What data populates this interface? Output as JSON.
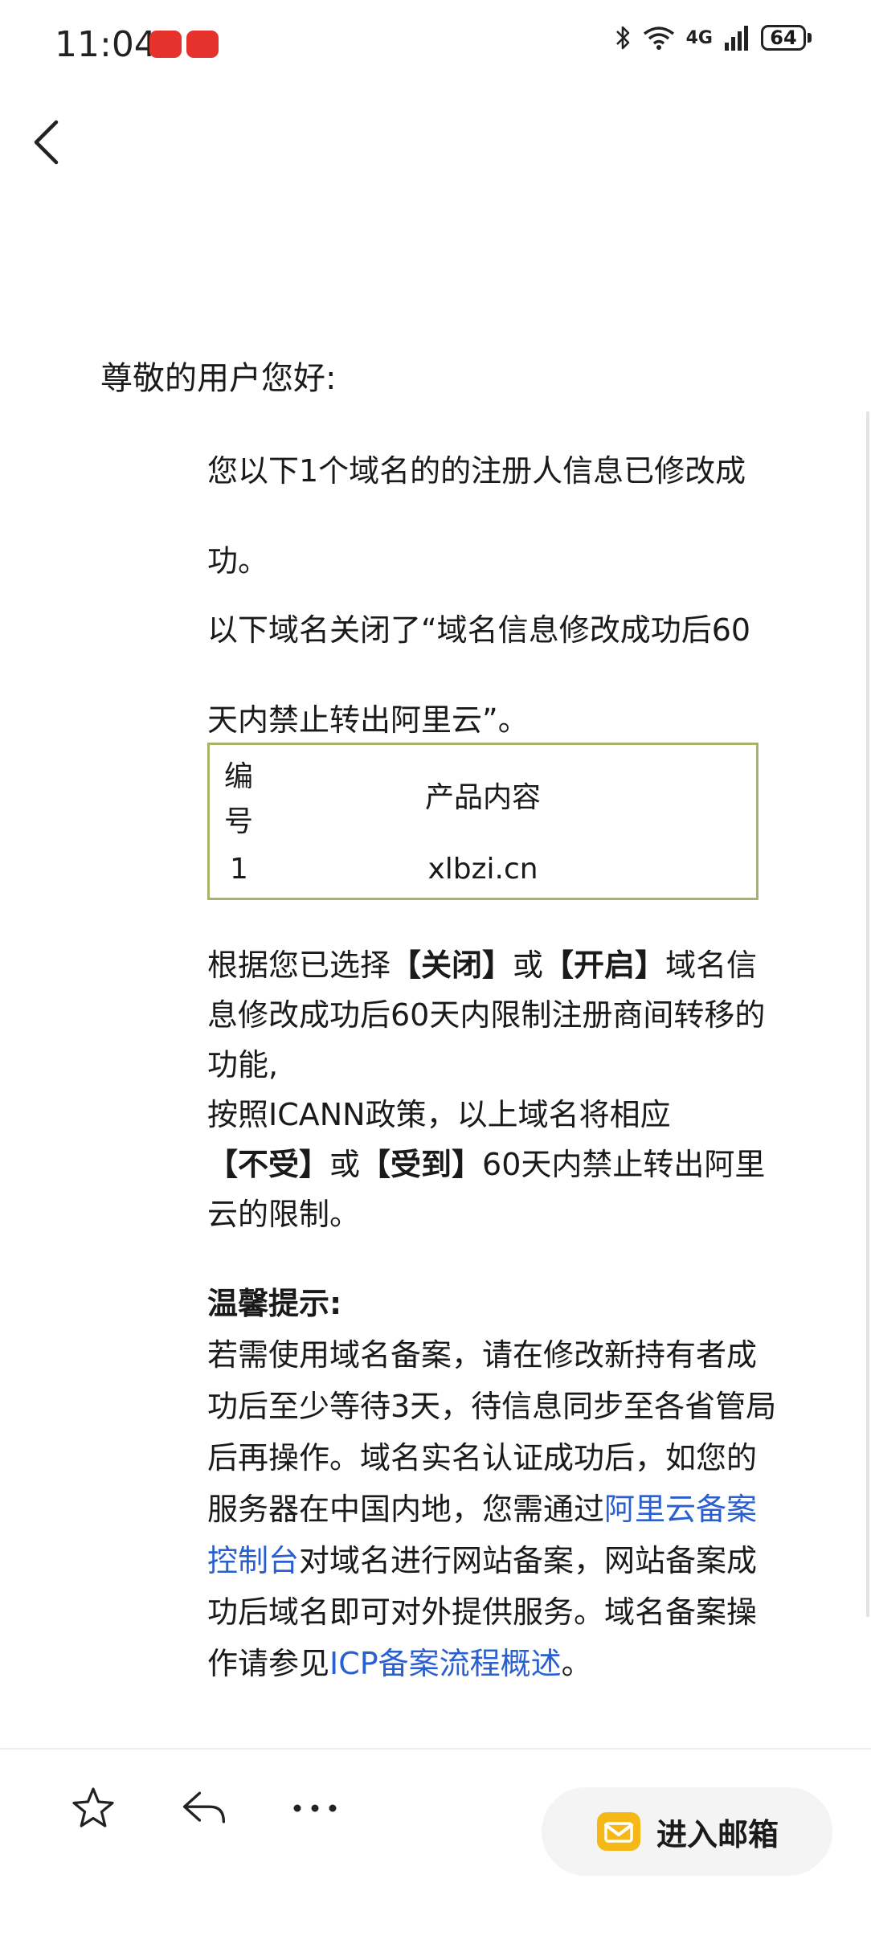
{
  "status_bar": {
    "time": "11:04",
    "network": "4G",
    "battery": "64",
    "icons": [
      "bluetooth-icon",
      "wifi-icon",
      "signal-icon",
      "battery-icon"
    ]
  },
  "email": {
    "greeting": "尊敬的用户您好:",
    "intro": "您以下1个域名的的注册人信息已修改成功。",
    "notice": "以下域名关闭了“域名信息修改成功后60天内禁止转出阿里云”。",
    "table": {
      "headers": [
        "编号",
        "产品内容"
      ],
      "rows": [
        {
          "no": "1",
          "content": "xlbzi.cn"
        }
      ]
    },
    "policy": {
      "t1": "根据您已选择",
      "b1": "【关闭】",
      "t2": "或",
      "b2": "【开启】",
      "t3": "域名信息修改成功后60天内限制注册商间转移的功能,",
      "t4": "按照ICANN政策，以上域名将相应",
      "b3": "【不受】",
      "t5": "或",
      "b4": "【受到】",
      "t6": "60天内禁止转出阿里云的限制。"
    },
    "tip": {
      "title": "温馨提示:",
      "t1": "若需使用域名备案，请在修改新持有者成功后至少等待3天，待信息同步至各省管局后再操作。域名实名认证成功后，如您的服务器在中国内地，您需通过",
      "link1": "阿里云备案控制台",
      "t2": "对域名进行网站备案，网站备案成功后域名即可对外提供服务。域名备案操作请参见",
      "link2": "ICP备案流程概述",
      "t3": "。"
    }
  },
  "bottom_bar": {
    "inbox_label": "进入邮箱",
    "icons": [
      "star-icon",
      "reply-icon",
      "more-icon",
      "mailbox-icon"
    ]
  },
  "colors": {
    "link": "#2a5fcf",
    "table_border": "#a7b36a",
    "mailbox_icon": "#f6b816"
  }
}
